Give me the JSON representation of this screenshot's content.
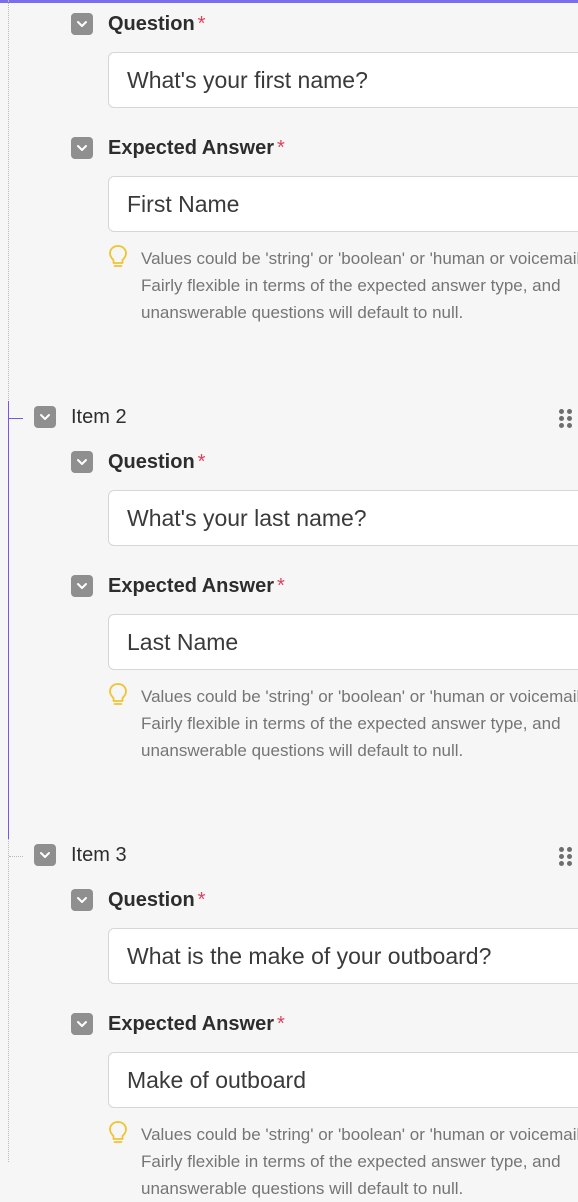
{
  "colors": {
    "accent": "#7b6cf0",
    "active_guide": "#7b55e8",
    "required": "#e0405a",
    "hint_icon": "#f0c330",
    "checkbox": "#8f8f8f"
  },
  "item1": {
    "question_label": "Question",
    "question_value": "What's your first name?",
    "answer_label": "Expected Answer",
    "answer_value": "First Name",
    "hint": "Values could be 'string' or 'boolean' or 'human or voicemail'. Fairly flexible in terms of the expected answer type, and unanswerable questions will default to null."
  },
  "item2": {
    "title": "Item 2",
    "question_label": "Question",
    "question_value": "What's your last name?",
    "answer_label": "Expected Answer",
    "answer_value": "Last Name",
    "hint": "Values could be 'string' or 'boolean' or 'human or voicemail'. Fairly flexible in terms of the expected answer type, and unanswerable questions will default to null."
  },
  "item3": {
    "title": "Item 3",
    "question_label": "Question",
    "question_value": "What is the make of your outboard?",
    "answer_label": "Expected Answer",
    "answer_value": "Make of outboard",
    "hint": "Values could be 'string' or 'boolean' or 'human or voicemail'. Fairly flexible in terms of the expected answer type, and unanswerable questions will default to null."
  },
  "required_marker": "*",
  "icons": {
    "collapse": "chevron-down-icon",
    "hint": "lightbulb-icon",
    "drag": "drag-handle-icon"
  }
}
